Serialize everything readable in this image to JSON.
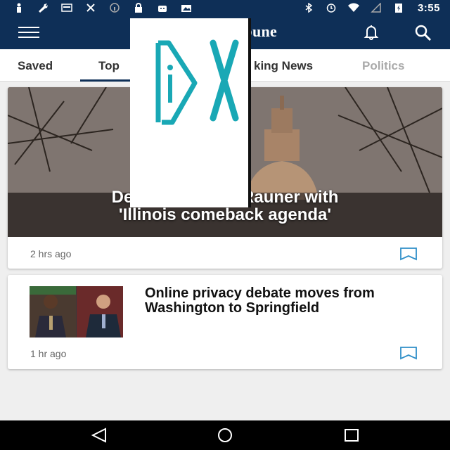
{
  "status_bar": {
    "time": "3:55",
    "icons": [
      "person-icon",
      "wrench-icon",
      "card-icon",
      "no-signal-icon",
      "lock-icon",
      "android-icon",
      "photo-icon",
      "bluetooth-icon",
      "alarm-icon",
      "wifi-icon",
      "no-sim-icon",
      "battery-icon"
    ]
  },
  "app_bar": {
    "brand": "ibune",
    "icons": [
      "menu-icon",
      "bell-icon",
      "search-icon"
    ]
  },
  "tabs": [
    {
      "label": "Saved"
    },
    {
      "label": "Top"
    },
    {
      "label": "king News"
    },
    {
      "label": "Politics"
    }
  ],
  "articles": [
    {
      "title_line1": "Democr            r Rauner with",
      "title_line2": "'Illinois comeback agenda'",
      "time": "2 hrs ago"
    },
    {
      "title": "Online privacy debate moves from Washington to Springfield",
      "time": "1 hr ago"
    }
  ],
  "overlay": {
    "logo_text": "iDX"
  },
  "colors": {
    "header": "#0e2f57",
    "accent": "#2f8fc8",
    "logo": "#19a8b5"
  }
}
